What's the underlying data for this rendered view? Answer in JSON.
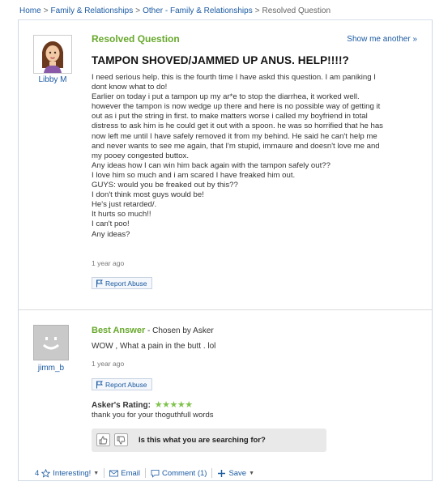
{
  "breadcrumb": {
    "home": "Home",
    "category": "Family & Relationships",
    "subcategory": "Other - Family & Relationships",
    "current": "Resolved Question",
    "separator": ">"
  },
  "question": {
    "status": "Resolved Question",
    "show_another": "Show me another »",
    "asker": "Libby M",
    "title": "TAMPON SHOVED/JAMMED UP ANUS. HELP!!!!?",
    "body_lines": [
      "I need serious help. this is the fourth time I have askd this question. I am paniking I",
      "dont know what to do!",
      "Earlier on today i put a tampon up my ar*e to stop the diarrhea, it worked well.",
      "however the tampon is now wedge up there and here is no possible way of getting it",
      "out as i put the string in first. to make matters worse i called my boyfriend in total",
      "distress to ask him is he could get it out with a spoon. he was so horrified that he has",
      "now left me until I have safely removed it from my behind. He said he can't help me",
      "and never wants to see me again, that I'm stupid, immaure and doesn't love me and",
      "my pooey congested buttox.",
      "Any ideas how I can win him back again with the tampon safely out??",
      "I love him so much and i am scared I have freaked him out.",
      "GUYS: would you be freaked out by this??",
      "I don't think most guys would be!",
      "He's just retarded/.",
      "It hurts so much!!",
      "I can't poo!",
      "Any ideas?"
    ],
    "time": "1 year ago",
    "report": "Report Abuse"
  },
  "answer": {
    "label": "Best Answer",
    "chosen_by": " - Chosen by Asker",
    "answerer": "jimm_b",
    "text": "WOW , What a pain in the butt . lol",
    "time": "1 year ago",
    "report": "Report Abuse",
    "rating_label": "Asker's Rating:",
    "rating_stars": "★★★★★",
    "rating_value": 5,
    "rating_max": 5,
    "rating_comment": "thank you for your thoguthfull words",
    "search_prompt": "Is this what you are searching for?"
  },
  "toolbar": {
    "interesting_count": "4",
    "interesting": "Interesting!",
    "email": "Email",
    "comment": "Comment (1)",
    "save": "Save"
  },
  "colors": {
    "link": "#1c5ba3",
    "green": "#67a82c",
    "star": "#7fc34b"
  }
}
